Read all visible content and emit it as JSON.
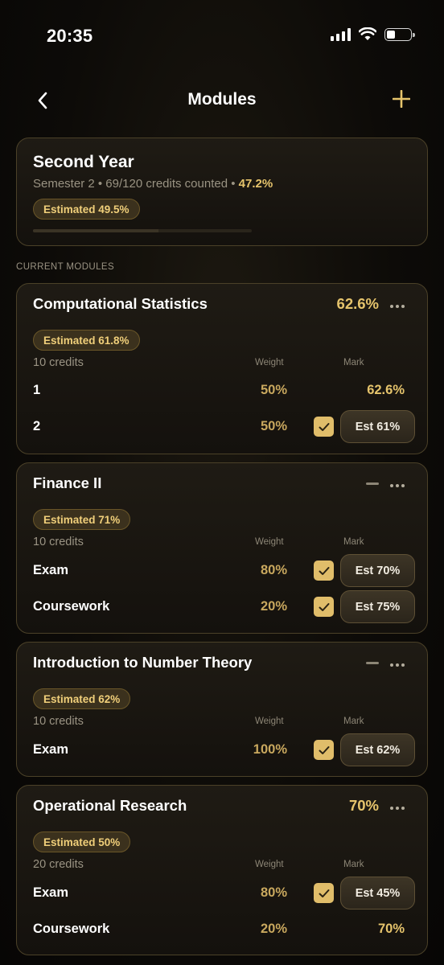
{
  "status_bar": {
    "time": "20:35"
  },
  "nav": {
    "title": "Modules"
  },
  "year": {
    "title": "Second Year",
    "subtitle": "Semester 2 • 69/120 credits counted • ",
    "percentage": "47.2%",
    "estimated": "Estimated 49.5%",
    "progress_fraction": 0.575
  },
  "section_label": "CURRENT MODULES",
  "columns": {
    "weight": "Weight",
    "mark": "Mark"
  },
  "modules": [
    {
      "title": "Computational Statistics",
      "score": "62.6%",
      "estimated": "Estimated 61.8%",
      "credits": "10 credits",
      "rows": [
        {
          "name": "1",
          "weight": "50%",
          "mark": "62.6%"
        },
        {
          "name": "2",
          "weight": "50%",
          "mark": "Est 61%",
          "checked": true
        }
      ]
    },
    {
      "title": "Finance II",
      "estimated": "Estimated 71%",
      "credits": "10 credits",
      "rows": [
        {
          "name": "Exam",
          "weight": "80%",
          "mark": "Est 70%",
          "checked": true
        },
        {
          "name": "Coursework",
          "weight": "20%",
          "mark": "Est 75%",
          "checked": true
        }
      ]
    },
    {
      "title": "Introduction to Number Theory",
      "estimated": "Estimated 62%",
      "credits": "10 credits",
      "rows": [
        {
          "name": "Exam",
          "weight": "100%",
          "mark": "Est 62%",
          "checked": true
        }
      ]
    },
    {
      "title": "Operational Research",
      "score": "70%",
      "estimated": "Estimated 50%",
      "credits": "20 credits",
      "rows": [
        {
          "name": "Exam",
          "weight": "80%",
          "mark": "Est 45%",
          "checked": true
        },
        {
          "name": "Coursework",
          "weight": "20%",
          "mark": "70%"
        }
      ]
    }
  ],
  "colors": {
    "accent": "#e6c46c",
    "background": "#0b0a08",
    "card_border": "#4b4128"
  }
}
